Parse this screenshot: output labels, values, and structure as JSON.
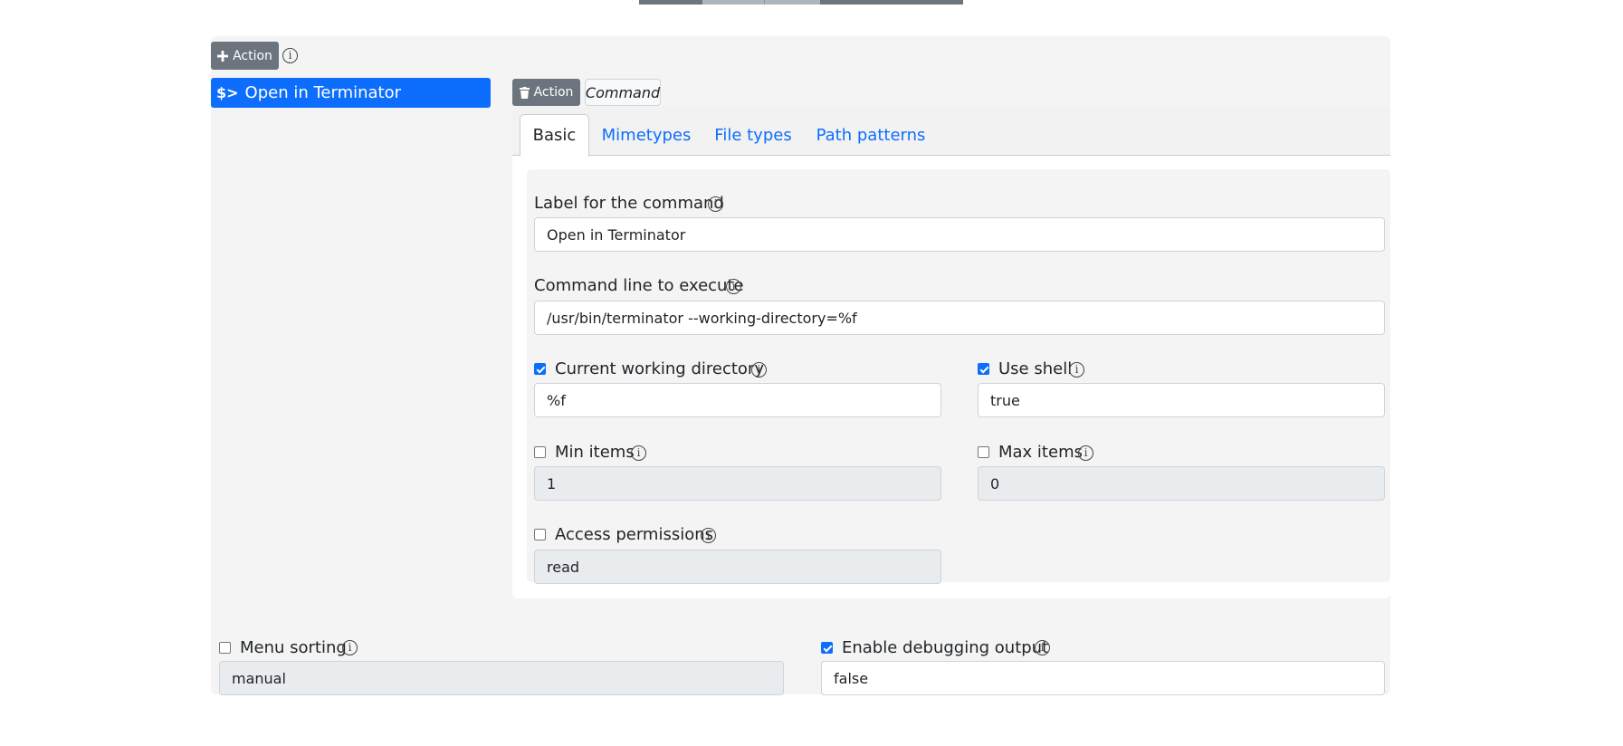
{
  "toolbar": {
    "add_action_label": "Action"
  },
  "actions": [
    {
      "prefix": "$>",
      "label": "Open in Terminator",
      "selected": true
    }
  ],
  "detail": {
    "delete_action_label": "Action",
    "type_badge": "Command",
    "tabs": [
      {
        "label": "Basic",
        "active": true
      },
      {
        "label": "Mimetypes",
        "active": false
      },
      {
        "label": "File types",
        "active": false
      },
      {
        "label": "Path patterns",
        "active": false
      }
    ],
    "fields": {
      "label": {
        "title": "Label for the command",
        "value": "Open in Terminator"
      },
      "command": {
        "title": "Command line to execute",
        "value": "/usr/bin/terminator --working-directory=%f"
      },
      "cwd": {
        "title": "Current working directory",
        "value": "%f",
        "checked": true
      },
      "use_shell": {
        "title": "Use shell",
        "value": "true",
        "checked": true
      },
      "min_items": {
        "title": "Min items",
        "value": "1",
        "checked": false
      },
      "max_items": {
        "title": "Max items",
        "value": "0",
        "checked": false
      },
      "permissions": {
        "title": "Access permissions",
        "value": "read",
        "checked": false
      }
    }
  },
  "global": {
    "menu_sorting": {
      "title": "Menu sorting",
      "value": "manual",
      "checked": false
    },
    "debug": {
      "title": "Enable debugging output",
      "value": "false",
      "checked": true
    }
  },
  "icons": {
    "info": "i",
    "add": "plus-icon",
    "delete": "trash-icon"
  },
  "colors": {
    "primary": "#0d6efd",
    "secondary": "#6c757d",
    "panel_bg": "#f4f4f4",
    "disabled_input": "#e9ecef"
  }
}
